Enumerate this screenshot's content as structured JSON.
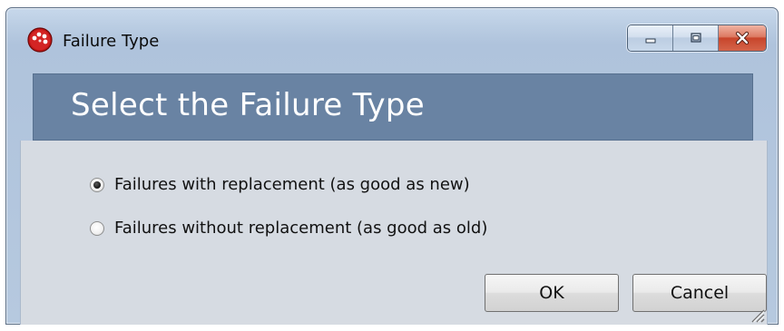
{
  "window": {
    "title": "Failure Type",
    "icon": "app-red-icon",
    "controls": {
      "minimize": "minimize-icon",
      "maximize": "maximize-icon",
      "close": "close-icon"
    }
  },
  "header": {
    "title": "Select the Failure Type"
  },
  "options": [
    {
      "label": "Failures with replacement (as good as new)",
      "selected": true
    },
    {
      "label": "Failures without replacement (as good as old)",
      "selected": false
    }
  ],
  "buttons": {
    "ok_label": "OK",
    "cancel_label": "Cancel"
  },
  "colors": {
    "header_band": "#6983a3",
    "client_background": "#d6dbe2",
    "close_button": "#c8452b"
  }
}
